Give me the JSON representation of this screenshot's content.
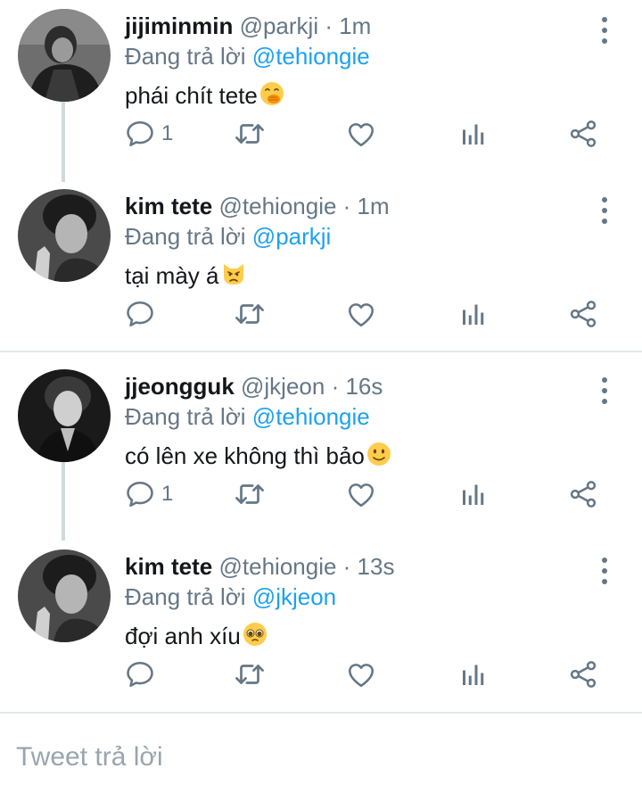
{
  "replying_label": "Đang trả lời",
  "tweets": [
    {
      "name": "jijiminmin",
      "meta": "@parkji · 1m",
      "reply_to": "@tehiongie",
      "text": "phái chít tete",
      "emoji": "face-with-hand-over-mouth",
      "reply_count": "1",
      "retweet_count": "",
      "like_count": ""
    },
    {
      "name": "kim tete",
      "meta": "@tehiongie · 1m",
      "reply_to": "@parkji",
      "text": "tại mày á",
      "emoji": "pouting-cat",
      "reply_count": "",
      "retweet_count": "",
      "like_count": ""
    },
    {
      "name": "jjeongguk",
      "meta": "@jkjeon · 16s",
      "reply_to": "@tehiongie",
      "text": "có lên xe không thì bảo",
      "emoji": "slightly-smiling-face",
      "reply_count": "1",
      "retweet_count": "",
      "like_count": ""
    },
    {
      "name": "kim tete",
      "meta": "@tehiongie · 13s",
      "reply_to": "@jkjeon",
      "text": "đợi anh xíu",
      "emoji": "pleading-face",
      "reply_count": "",
      "retweet_count": "",
      "like_count": ""
    }
  ],
  "compose": {
    "placeholder": "Tweet trả lời"
  },
  "colors": {
    "link": "#1da1f2",
    "secondary_text": "#657786",
    "icon": "#657786",
    "thread_line": "#cfd9de",
    "separator": "#e1e8ed"
  }
}
